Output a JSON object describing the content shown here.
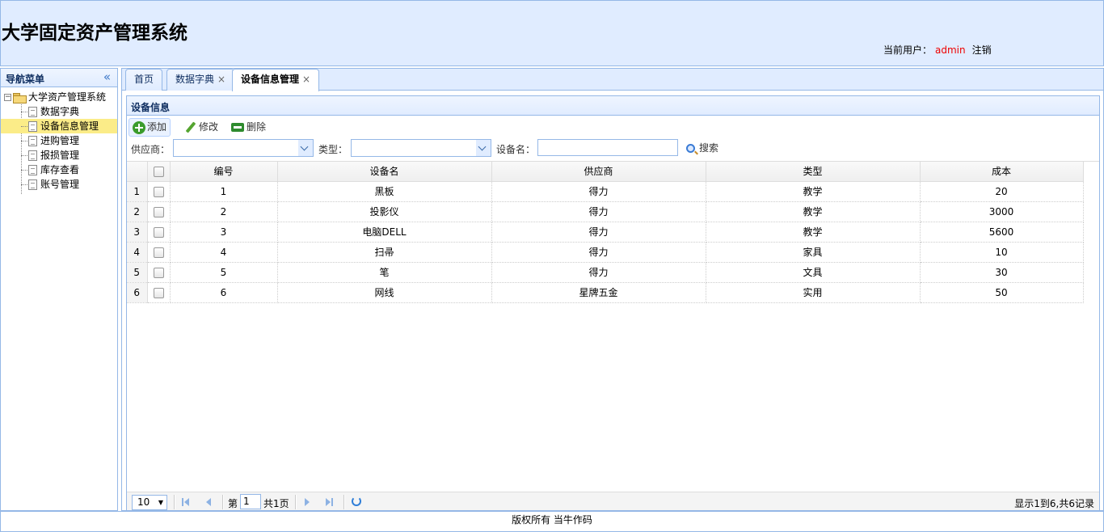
{
  "header": {
    "title": "大学固定资产管理系统",
    "user_label": "当前用户：",
    "user_name": "admin",
    "logout": "注销"
  },
  "nav": {
    "title": "导航菜单",
    "collapse_icon": "«",
    "root": "大学资产管理系统",
    "items": [
      {
        "label": "数据字典",
        "selected": false
      },
      {
        "label": "设备信息管理",
        "selected": true
      },
      {
        "label": "进购管理",
        "selected": false
      },
      {
        "label": "报损管理",
        "selected": false
      },
      {
        "label": "库存查看",
        "selected": false
      },
      {
        "label": "账号管理",
        "selected": false
      }
    ]
  },
  "tabs": [
    {
      "label": "首页",
      "closable": false
    },
    {
      "label": "数据字典",
      "closable": true
    },
    {
      "label": "设备信息管理",
      "closable": true,
      "active": true
    }
  ],
  "tab_close": "×",
  "panel": {
    "title": "设备信息",
    "toolbar": {
      "add": "添加",
      "edit": "修改",
      "delete": "删除"
    },
    "filters": {
      "supplier_label": "供应商：",
      "type_label": "类型：",
      "name_label": "设备名：",
      "search": "搜索"
    }
  },
  "grid": {
    "columns": [
      "编号",
      "设备名",
      "供应商",
      "类型",
      "成本"
    ],
    "rows": [
      {
        "rn": "1",
        "id": "1",
        "name": "黑板",
        "supplier": "得力",
        "type": "教学",
        "cost": "20"
      },
      {
        "rn": "2",
        "id": "2",
        "name": "投影仪",
        "supplier": "得力",
        "type": "教学",
        "cost": "3000"
      },
      {
        "rn": "3",
        "id": "3",
        "name": "电脑DELL",
        "supplier": "得力",
        "type": "教学",
        "cost": "5600"
      },
      {
        "rn": "4",
        "id": "4",
        "name": "扫帚",
        "supplier": "得力",
        "type": "家具",
        "cost": "10"
      },
      {
        "rn": "5",
        "id": "5",
        "name": "笔",
        "supplier": "得力",
        "type": "文具",
        "cost": "30"
      },
      {
        "rn": "6",
        "id": "6",
        "name": "网线",
        "supplier": "星牌五金",
        "type": "实用",
        "cost": "50"
      }
    ]
  },
  "pager": {
    "page_size": "10",
    "page_prefix": "第",
    "page_value": "1",
    "page_suffix": "共1页",
    "info": "显示1到6,共6记录"
  },
  "footer": "版权所有  当牛作码"
}
